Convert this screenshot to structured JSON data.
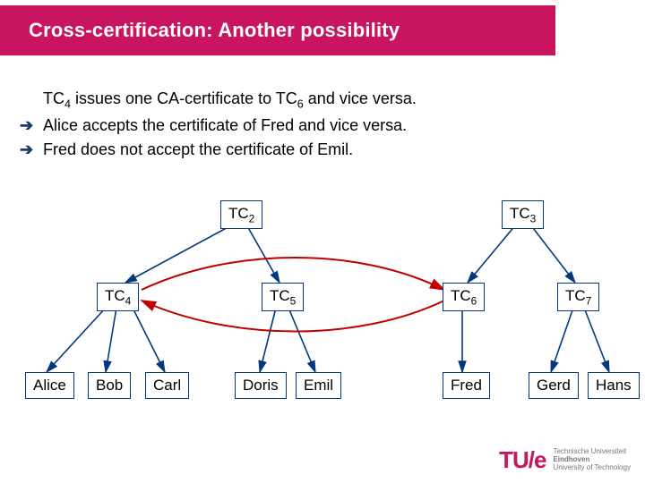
{
  "title": "Cross-certification: Another possibility",
  "body": {
    "line1_pre": "TC",
    "line1_sub1": "4",
    "line1_mid": " issues one CA-certificate to TC",
    "line1_sub2": "6",
    "line1_post": " and vice versa.",
    "arrow": "➔",
    "line2": "Alice accepts the certificate of Fred and vice versa.",
    "line3": "Fred does not accept the certificate of Emil."
  },
  "nodes": {
    "tc2_t": "TC",
    "tc2_s": "2",
    "tc3_t": "TC",
    "tc3_s": "3",
    "tc4_t": "TC",
    "tc4_s": "4",
    "tc5_t": "TC",
    "tc5_s": "5",
    "tc6_t": "TC",
    "tc6_s": "6",
    "tc7_t": "TC",
    "tc7_s": "7",
    "alice": "Alice",
    "bob": "Bob",
    "carl": "Carl",
    "doris": "Doris",
    "emil": "Emil",
    "fred": "Fred",
    "gerd": "Gerd",
    "hans": "Hans"
  },
  "logo": {
    "mark": "TU/e",
    "l1": "Technische Universiteit",
    "l2": "Eindhoven",
    "l3": "University of Technology"
  }
}
